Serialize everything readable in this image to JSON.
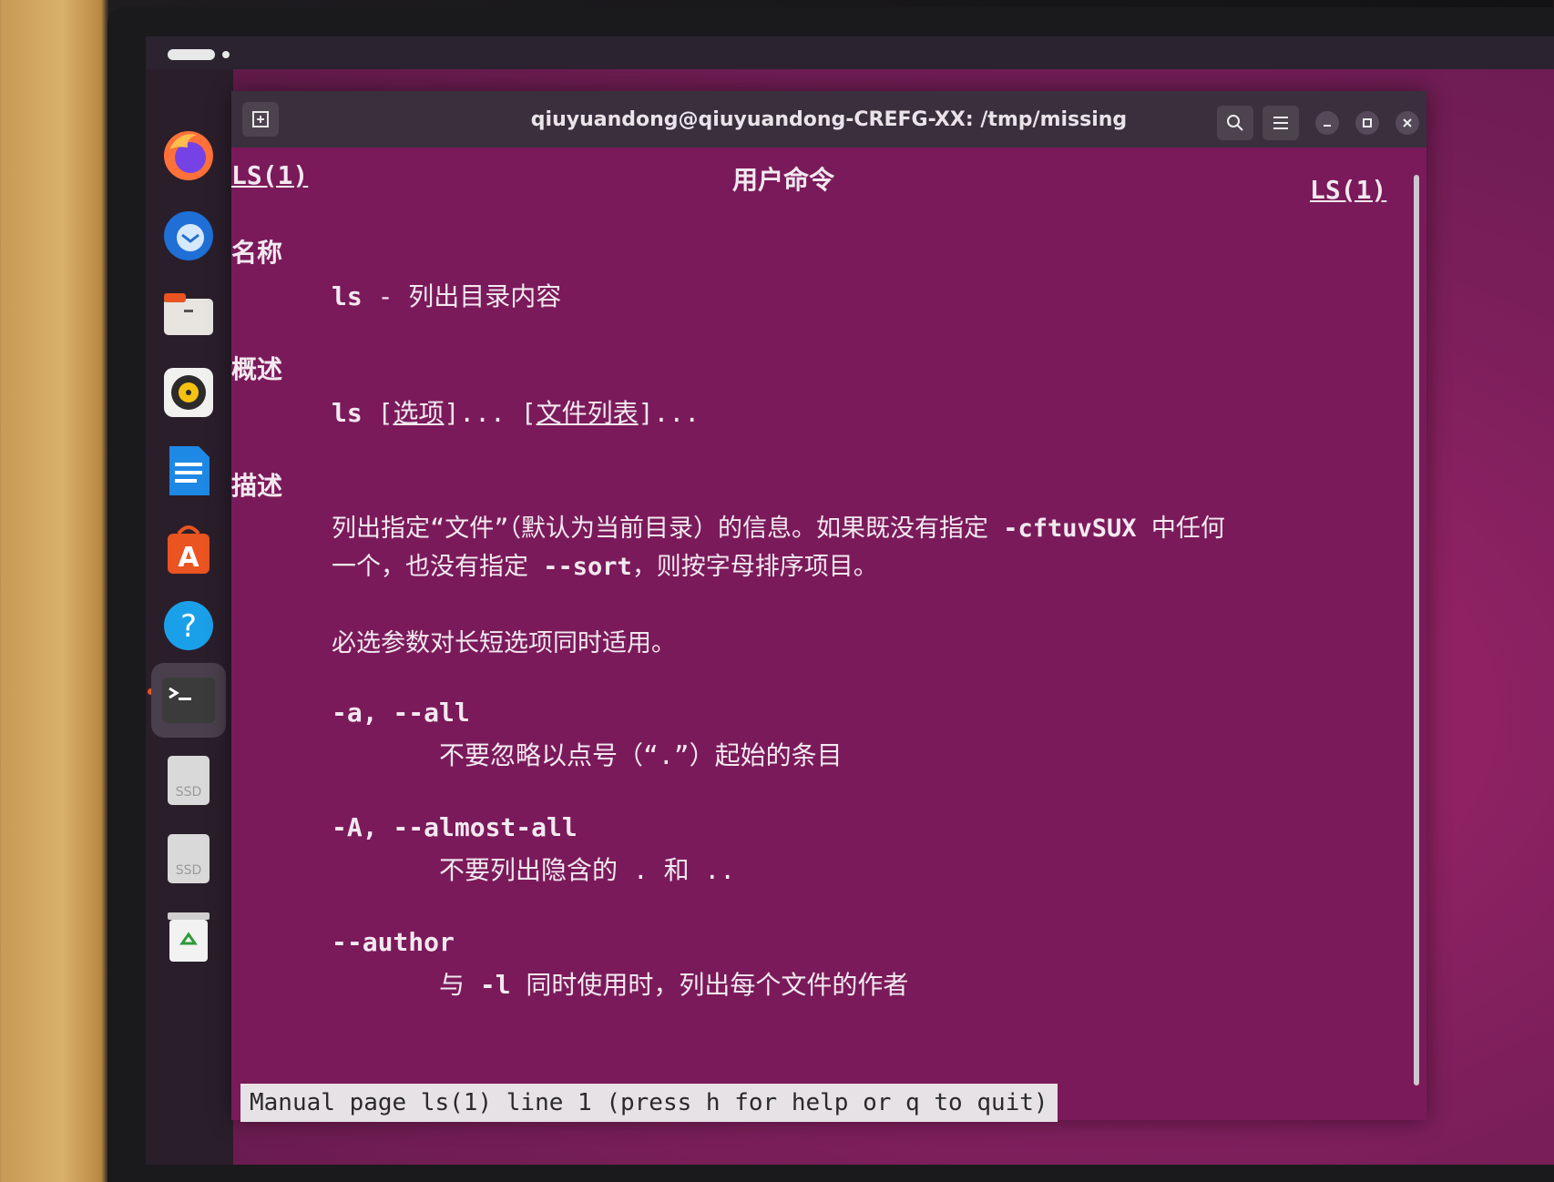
{
  "window": {
    "title": "qiuyuandong@qiuyuandong-CREFG-XX: /tmp/missing"
  },
  "dock": {
    "apps": [
      {
        "name": "firefox-icon"
      },
      {
        "name": "thunderbird-icon"
      },
      {
        "name": "files-icon"
      },
      {
        "name": "rhythmbox-icon"
      },
      {
        "name": "libreoffice-writer-icon"
      },
      {
        "name": "software-center-icon"
      },
      {
        "name": "help-icon"
      },
      {
        "name": "terminal-icon"
      },
      {
        "name": "ssd-drive-icon",
        "label": "SSD"
      },
      {
        "name": "ssd-drive-icon",
        "label": "SSD"
      },
      {
        "name": "trash-icon"
      }
    ]
  },
  "man": {
    "header_left": "LS(1)",
    "header_center": "用户命令",
    "header_right": "LS(1)",
    "name_heading": "名称",
    "name_cmd": "ls",
    "name_desc": " - 列出目录内容",
    "synopsis_heading": "概述",
    "synopsis_cmd": "ls",
    "synopsis_opt": "选项",
    "synopsis_files": "文件列表",
    "synopsis_mid": "]... [",
    "synopsis_end": "]...",
    "description_heading": "描述",
    "desc_line1_a": "列出指定“文件”（默认为当前目录）的信息。如果既没有指定 ",
    "desc_line1_opt": "-cftuvSUX",
    "desc_line1_b": " 中任何",
    "desc_line2_a": "一个，也没有指定 ",
    "desc_line2_opt": "--sort",
    "desc_line2_b": "，则按字母排序项目。",
    "desc_line3": "必选参数对长短选项同时适用。",
    "options": [
      {
        "flag": "-a, --all",
        "desc": "不要忽略以点号（“.”）起始的条目"
      },
      {
        "flag": "-A, --almost-all",
        "desc": "不要列出隐含的 . 和 .."
      },
      {
        "flag": "--author",
        "desc_a": "与 ",
        "desc_opt": "-l",
        "desc_b": " 同时使用时，列出每个文件的作者"
      }
    ],
    "status_line": "Manual page ls(1) line 1 (press h for help or q to quit)"
  }
}
